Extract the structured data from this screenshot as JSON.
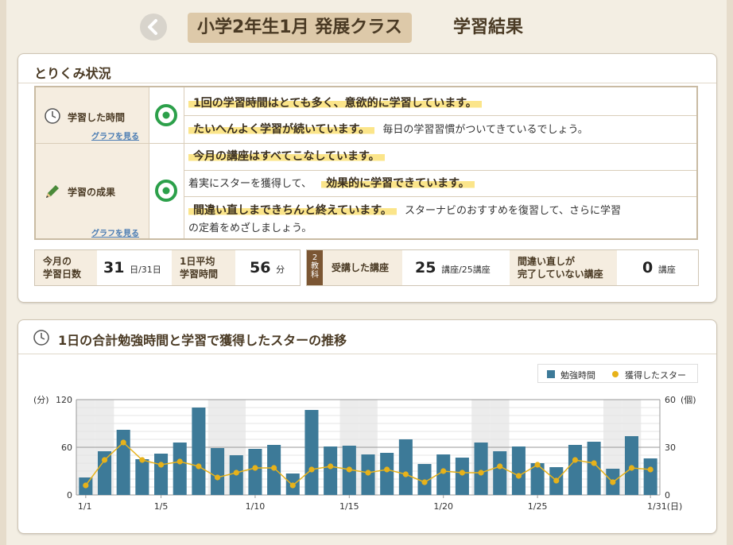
{
  "header": {
    "class_title": "小学2年生1月 発展クラス",
    "page_title": "学習結果"
  },
  "status": {
    "title": "とりくみ状況",
    "study_time": {
      "label": "学習した時間",
      "graph_link": "グラフを見る",
      "icon": "clock-icon",
      "rating_icon": "double-circle-icon",
      "messages": [
        {
          "highlight": "1回の学習時間はとても多く、意欲的に学習しています。",
          "plain": ""
        },
        {
          "highlight": "たいへんよく学習が続いています。",
          "plain": "毎日の学習習慣がついてきているでしょう。"
        }
      ]
    },
    "results": {
      "label": "学習の成果",
      "graph_link": "グラフを見る",
      "icon": "pencil-icon",
      "rating_icon": "double-circle-icon",
      "messages": [
        {
          "highlight": "今月の講座はすべてこなしています。"
        },
        {
          "pre": "着実にスターを獲得して、",
          "highlight": "効果的に学習できています。"
        },
        {
          "highlight": "間違い直しまできちんと終えています。",
          "plain": "スターナビのおすすめを復習して、さらに学習",
          "plain2": "の定着をめざしましょう。"
        }
      ]
    }
  },
  "stats": {
    "days_label1": "今月の",
    "days_label2": "学習日数",
    "days_value": "31",
    "days_unit": "日/31日",
    "avg_label1": "1日平均",
    "avg_label2": "学習時間",
    "avg_value": "56",
    "avg_unit": "分",
    "subject_tag1": "2",
    "subject_tag2": "教",
    "subject_tag3": "科",
    "lessons_label": "受講した講座",
    "lessons_value": "25",
    "lessons_unit": "講座/25講座",
    "review_label1": "間違い直しが",
    "review_label2": "完了していない講座",
    "review_value": "0",
    "review_unit": "講座"
  },
  "chart_panel": {
    "title": "1日の合計勉強時間と学習で獲得したスターの推移"
  },
  "chart_data": {
    "type": "bar",
    "legend": [
      "勉強時間",
      "獲得したスター"
    ],
    "legend_position": "top-right",
    "y_left_label": "(分)",
    "y_right_label": "(個)",
    "y_left_ticks": [
      "120",
      "60",
      "0"
    ],
    "y_right_ticks": [
      "60",
      "30",
      "0"
    ],
    "ylim_left": [
      0,
      120
    ],
    "ylim_right": [
      0,
      60
    ],
    "x_ticks": [
      {
        "day": 1,
        "label": "1/1"
      },
      {
        "day": 5,
        "label": "1/5"
      },
      {
        "day": 10,
        "label": "1/10"
      },
      {
        "day": 15,
        "label": "1/15"
      },
      {
        "day": 20,
        "label": "1/20"
      },
      {
        "day": 25,
        "label": "1/25"
      },
      {
        "day": 31,
        "label": "1/31(日)"
      }
    ],
    "weekend_days": [
      1,
      2,
      8,
      9,
      15,
      16,
      22,
      23,
      29,
      30
    ],
    "days": [
      1,
      2,
      3,
      4,
      5,
      6,
      7,
      8,
      9,
      10,
      11,
      12,
      13,
      14,
      15,
      16,
      17,
      18,
      19,
      20,
      21,
      22,
      23,
      24,
      25,
      26,
      27,
      28,
      29,
      30,
      31
    ],
    "series": [
      {
        "name": "勉強時間",
        "color": "#3d7a98",
        "values": [
          22,
          55,
          82,
          45,
          52,
          66,
          110,
          59,
          50,
          58,
          63,
          27,
          107,
          61,
          62,
          51,
          53,
          70,
          39,
          51,
          47,
          66,
          55,
          61,
          40,
          35,
          63,
          67,
          33,
          74,
          46
        ]
      },
      {
        "name": "獲得したスター",
        "color": "#e7b21a",
        "values": [
          6,
          22,
          33,
          22,
          19,
          21,
          18,
          11,
          14,
          17,
          17,
          6,
          16,
          18,
          16,
          14,
          16,
          13,
          8,
          15,
          14,
          14,
          18,
          12,
          19,
          9,
          22,
          20,
          8,
          17,
          16
        ]
      }
    ]
  }
}
